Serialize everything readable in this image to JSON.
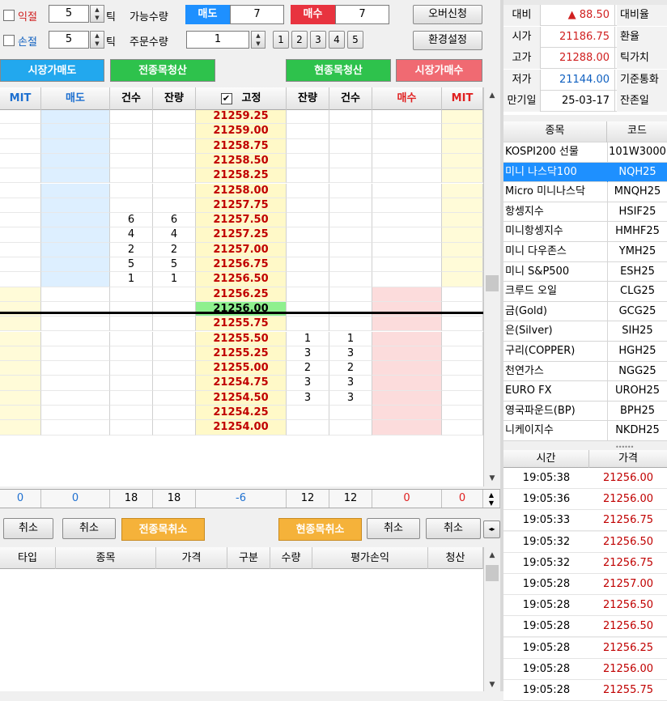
{
  "top": {
    "ikjeol_label": "익절",
    "ikjeol_value": "5",
    "son_label": "손절",
    "son_value": "5",
    "tick_label": "틱",
    "avail_label": "가능수량",
    "sell_tag": "매도",
    "sell_avail": "7",
    "buy_tag": "매수",
    "buy_avail": "7",
    "overbuy_btn": "오버신청",
    "order_qty_label": "주문수량",
    "order_qty": "1",
    "qty_presets": [
      "1",
      "2",
      "3",
      "4",
      "5"
    ],
    "env_btn": "환경설정",
    "market_sell_btn": "시장가매도",
    "all_clear_btn": "전종목청산",
    "cur_clear_btn": "현종목청산",
    "market_buy_btn": "시장가매수"
  },
  "grid": {
    "headers": {
      "mit_l": "MIT",
      "sell": "매도",
      "cnt_l": "건수",
      "rem_l": "잔량",
      "fixed": "고정",
      "rem_r": "잔량",
      "cnt_r": "건수",
      "buy": "매수",
      "mit_r": "MIT"
    },
    "rows": [
      {
        "price": "21259.25",
        "sc": "",
        "sr": "",
        "br": "",
        "bc": ""
      },
      {
        "price": "21259.00",
        "sc": "",
        "sr": "",
        "br": "",
        "bc": ""
      },
      {
        "price": "21258.75",
        "sc": "",
        "sr": "",
        "br": "",
        "bc": ""
      },
      {
        "price": "21258.50",
        "sc": "",
        "sr": "",
        "br": "",
        "bc": ""
      },
      {
        "price": "21258.25",
        "sc": "",
        "sr": "",
        "br": "",
        "bc": ""
      },
      {
        "price": "21258.00",
        "sc": "",
        "sr": "",
        "br": "",
        "bc": ""
      },
      {
        "price": "21257.75",
        "sc": "",
        "sr": "",
        "br": "",
        "bc": ""
      },
      {
        "price": "21257.50",
        "sc": "6",
        "sr": "6",
        "br": "",
        "bc": ""
      },
      {
        "price": "21257.25",
        "sc": "4",
        "sr": "4",
        "br": "",
        "bc": ""
      },
      {
        "price": "21257.00",
        "sc": "2",
        "sr": "2",
        "br": "",
        "bc": ""
      },
      {
        "price": "21256.75",
        "sc": "5",
        "sr": "5",
        "br": "",
        "bc": ""
      },
      {
        "price": "21256.50",
        "sc": "1",
        "sr": "1",
        "br": "",
        "bc": ""
      },
      {
        "price": "21256.25",
        "sc": "",
        "sr": "",
        "br": "",
        "bc": ""
      },
      {
        "price": "21256.00",
        "sc": "",
        "sr": "",
        "br": "",
        "bc": "",
        "current": true
      },
      {
        "price": "21255.75",
        "sc": "",
        "sr": "",
        "br": "",
        "bc": ""
      },
      {
        "price": "21255.50",
        "sc": "",
        "sr": "",
        "br": "1",
        "bc": "1"
      },
      {
        "price": "21255.25",
        "sc": "",
        "sr": "",
        "br": "3",
        "bc": "3"
      },
      {
        "price": "21255.00",
        "sc": "",
        "sr": "",
        "br": "2",
        "bc": "2"
      },
      {
        "price": "21254.75",
        "sc": "",
        "sr": "",
        "br": "3",
        "bc": "3"
      },
      {
        "price": "21254.50",
        "sc": "",
        "sr": "",
        "br": "3",
        "bc": "3"
      },
      {
        "price": "21254.25",
        "sc": "",
        "sr": "",
        "br": "",
        "bc": ""
      },
      {
        "price": "21254.00",
        "sc": "",
        "sr": "",
        "br": "",
        "bc": ""
      }
    ],
    "totals": {
      "mit_l": "0",
      "sell": "0",
      "cnt_l": "18",
      "rem_l": "18",
      "fixed": "-6",
      "rem_r": "12",
      "cnt_r": "12",
      "buy": "0",
      "mit_r": "0"
    }
  },
  "cancel": {
    "cancel": "취소",
    "all_cancel": "전종목취소",
    "cur_cancel": "현종목취소"
  },
  "positions": {
    "headers": [
      "타입",
      "종목",
      "가격",
      "구분",
      "수량",
      "평가손익",
      "청산"
    ]
  },
  "quote": [
    {
      "l": "대비",
      "v": "▲ 88.50",
      "r": "대비율"
    },
    {
      "l": "시가",
      "v": "21186.75",
      "r": "환율"
    },
    {
      "l": "고가",
      "v": "21288.00",
      "r": "틱가치"
    },
    {
      "l": "저가",
      "v": "21144.00",
      "r": "기준통화"
    },
    {
      "l": "만기일",
      "v": "25-03-17",
      "r": "잔존일"
    }
  ],
  "symbols": {
    "headers": {
      "name": "종목",
      "code": "코드"
    },
    "items": [
      {
        "name": "KOSPI200 선물",
        "code": "101W3000"
      },
      {
        "name": "미니 나스닥100",
        "code": "NQH25",
        "selected": true
      },
      {
        "name": "Micro 미니나스닥",
        "code": "MNQH25"
      },
      {
        "name": "항셍지수",
        "code": "HSIF25"
      },
      {
        "name": "미니항셍지수",
        "code": "HMHF25"
      },
      {
        "name": "미니 다우존스",
        "code": "YMH25"
      },
      {
        "name": "미니 S&P500",
        "code": "ESH25"
      },
      {
        "name": "크루드 오일",
        "code": "CLG25"
      },
      {
        "name": "금(Gold)",
        "code": "GCG25"
      },
      {
        "name": "은(Silver)",
        "code": "SIH25"
      },
      {
        "name": "구리(COPPER)",
        "code": "HGH25"
      },
      {
        "name": "천연가스",
        "code": "NGG25"
      },
      {
        "name": "EURO FX",
        "code": "UROH25"
      },
      {
        "name": "영국파운드(BP)",
        "code": "BPH25"
      },
      {
        "name": "니케이지수",
        "code": "NKDH25"
      }
    ]
  },
  "ticks": {
    "headers": {
      "time": "시간",
      "price": "가격"
    },
    "items": [
      {
        "time": "19:05:38",
        "price": "21256.00"
      },
      {
        "time": "19:05:36",
        "price": "21256.00"
      },
      {
        "time": "19:05:33",
        "price": "21256.75"
      },
      {
        "time": "19:05:32",
        "price": "21256.50"
      },
      {
        "time": "19:05:32",
        "price": "21256.75"
      },
      {
        "time": "19:05:28",
        "price": "21257.00"
      },
      {
        "time": "19:05:28",
        "price": "21256.50"
      },
      {
        "time": "19:05:28",
        "price": "21256.50"
      },
      {
        "time": "19:05:28",
        "price": "21256.25"
      },
      {
        "time": "19:05:28",
        "price": "21256.00"
      },
      {
        "time": "19:05:28",
        "price": "21255.75"
      }
    ]
  },
  "colors": {
    "sell_blue": "#1e90ff",
    "buy_red": "#e8333f",
    "price_red": "#c00000",
    "green_btn": "#2ec24c",
    "current_green": "#8ef08e"
  }
}
